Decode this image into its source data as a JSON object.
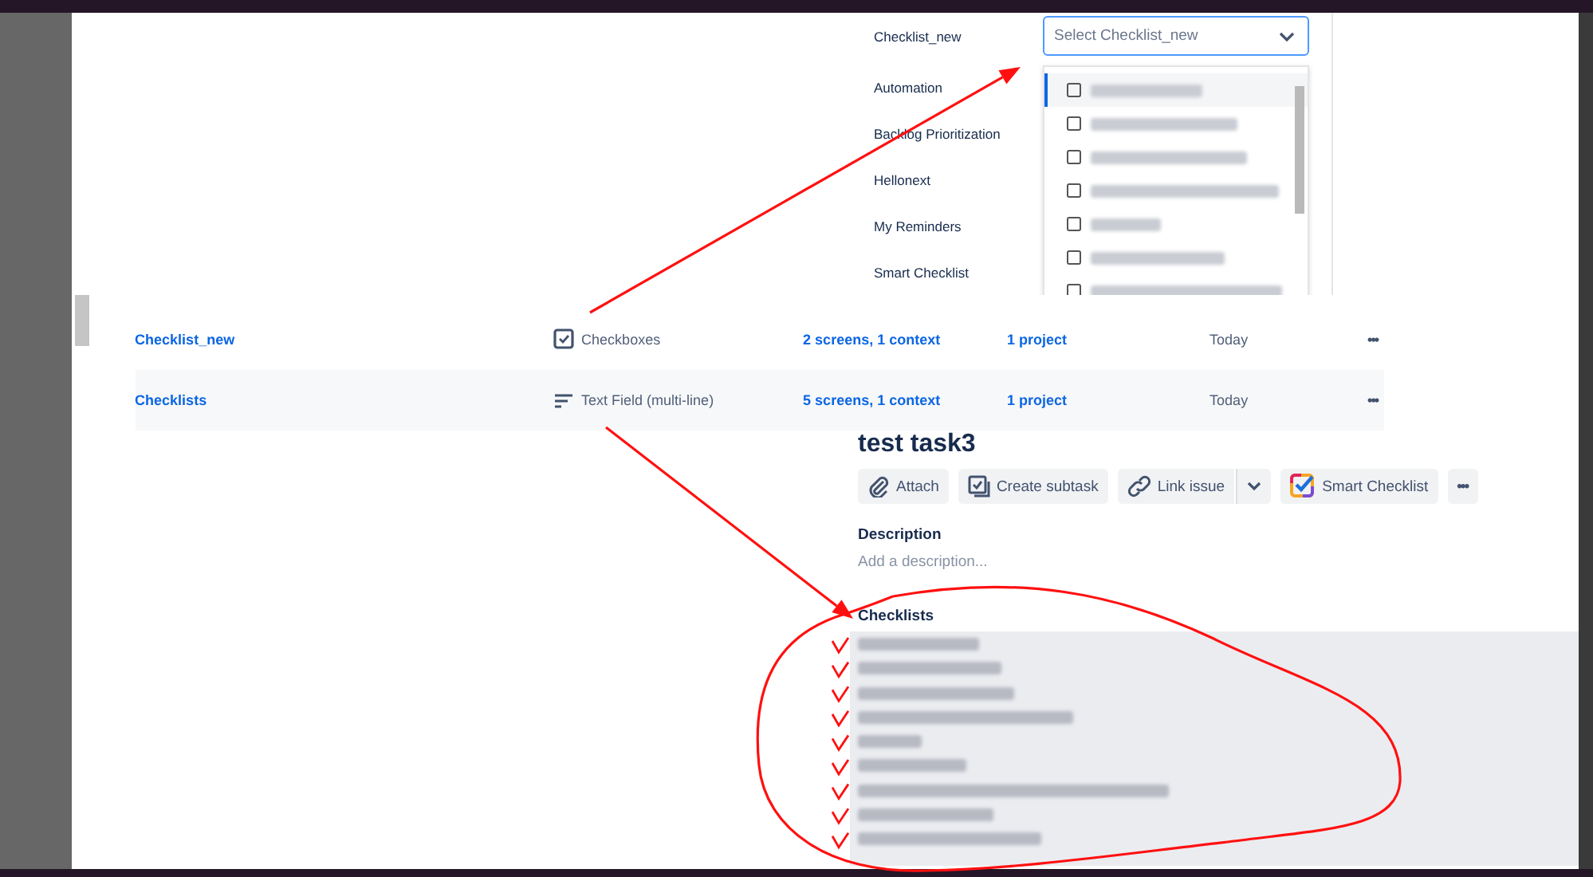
{
  "settings_panel": {
    "fields": [
      {
        "label": "Checklist_new"
      },
      {
        "label": "Automation"
      },
      {
        "label": "Backlog Prioritization"
      },
      {
        "label": "Hellonext"
      },
      {
        "label": "My Reminders"
      },
      {
        "label": "Smart Checklist"
      }
    ],
    "select": {
      "placeholder": "Select Checklist_new",
      "focused": true
    },
    "options": [
      {
        "checked": false,
        "selected": true
      },
      {
        "checked": false,
        "selected": false
      },
      {
        "checked": false,
        "selected": false
      },
      {
        "checked": false,
        "selected": false
      },
      {
        "checked": false,
        "selected": false
      },
      {
        "checked": false,
        "selected": false
      },
      {
        "checked": false,
        "selected": false
      }
    ]
  },
  "fields_table": {
    "rows": [
      {
        "name": "Checklist_new",
        "kind": "checkbox",
        "type": "Checkboxes",
        "screens": "2 screens, 1 context",
        "projects": "1 project",
        "updated": "Today",
        "actions": "•••"
      },
      {
        "name": "Checklists",
        "kind": "multiline",
        "type": "Text Field (multi-line)",
        "screens": "5 screens, 1 context",
        "projects": "1 project",
        "updated": "Today",
        "actions": "•••"
      }
    ]
  },
  "issue": {
    "title": "test task3",
    "buttons": [
      {
        "kind": "attach",
        "label": "Attach"
      },
      {
        "kind": "subtask",
        "label": "Create subtask"
      },
      {
        "kind": "link",
        "label": "Link issue"
      },
      {
        "kind": "caret"
      },
      {
        "kind": "smart",
        "label": "Smart Checklist"
      },
      {
        "kind": "more",
        "label": "•••"
      }
    ],
    "description_label": "Description",
    "description_placeholder": "Add a description...",
    "checklists_label": "Checklists",
    "checklist_items": [
      {
        "kind": "redacted"
      },
      {
        "kind": "redacted"
      },
      {
        "kind": "redacted"
      },
      {
        "kind": "redacted"
      },
      {
        "kind": "redacted"
      },
      {
        "kind": "redacted"
      },
      {
        "kind": "redacted"
      },
      {
        "kind": "redacted"
      },
      {
        "kind": "redacted"
      }
    ]
  },
  "annotations": [
    {
      "kind": "arrow"
    },
    {
      "kind": "arrow"
    },
    {
      "kind": "loop"
    },
    {
      "kind": "ticks"
    }
  ]
}
